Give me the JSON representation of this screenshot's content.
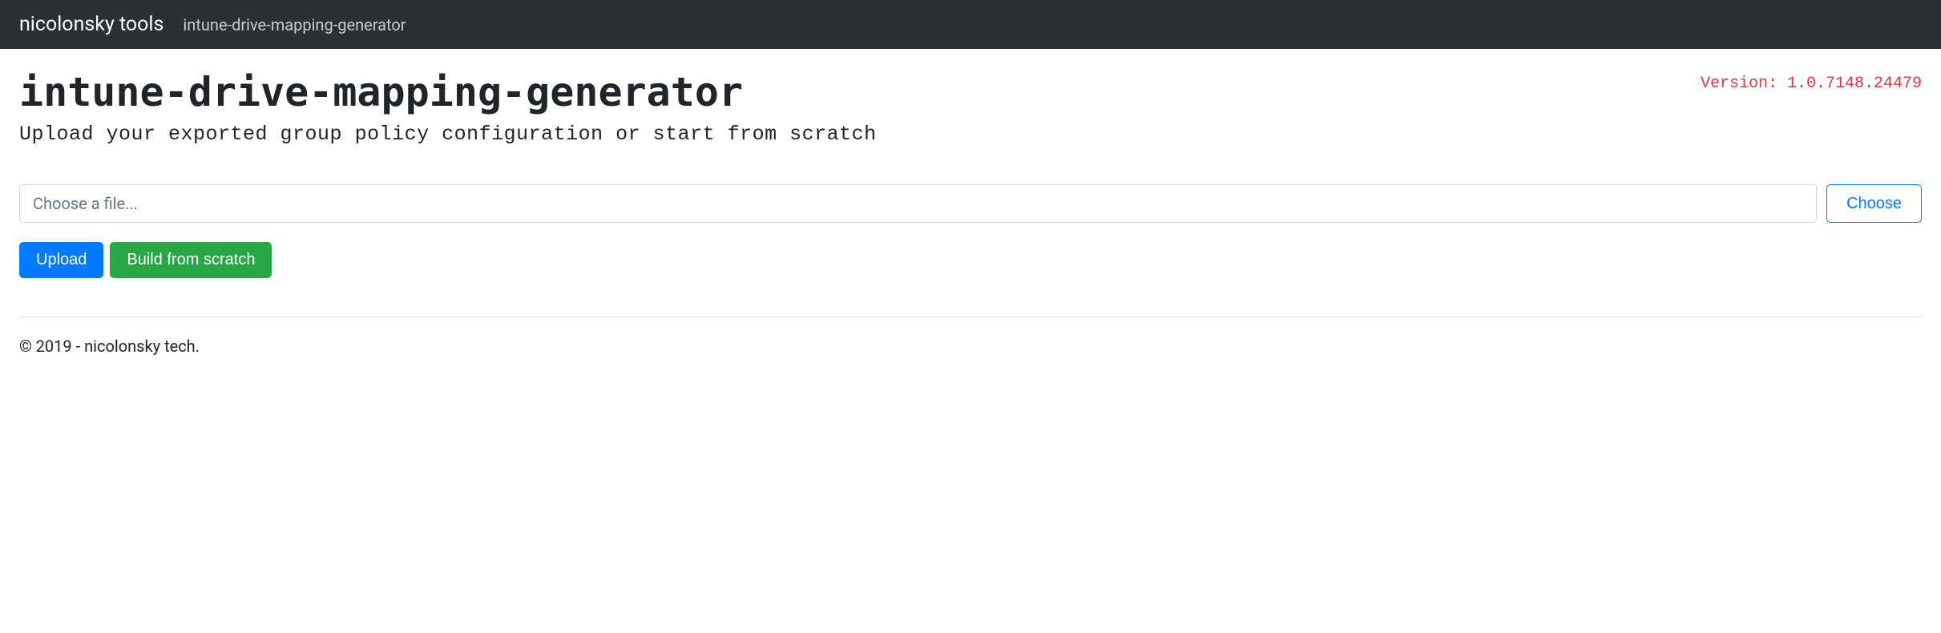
{
  "navbar": {
    "brand": "nicolonsky tools",
    "link": "intune-drive-mapping-generator"
  },
  "header": {
    "title": "intune-drive-mapping-generator",
    "version": "Version: 1.0.7148.24479",
    "subtitle": "Upload your exported group policy configuration or start from scratch"
  },
  "fileInput": {
    "placeholder": "Choose a file...",
    "chooseLabel": "Choose"
  },
  "buttons": {
    "upload": "Upload",
    "buildFromScratch": "Build from scratch"
  },
  "footer": {
    "text": "© 2019 - nicolonsky tech."
  }
}
